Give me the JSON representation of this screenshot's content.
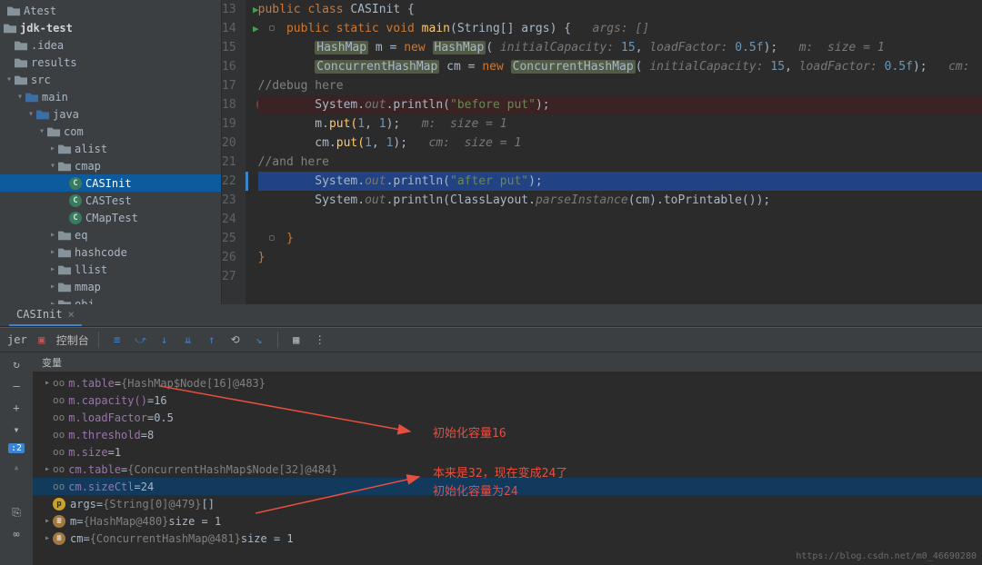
{
  "project": {
    "root_above": "Atest",
    "root": "jdk-test",
    "folders": [
      {
        "label": ".idea",
        "depth": 1,
        "arrow": ""
      },
      {
        "label": "results",
        "depth": 1,
        "arrow": ""
      },
      {
        "label": "src",
        "depth": 1,
        "arrow": "v"
      },
      {
        "label": "main",
        "depth": 2,
        "arrow": "v",
        "blue": true
      },
      {
        "label": "java",
        "depth": 3,
        "arrow": "v",
        "blue": true
      },
      {
        "label": "com",
        "depth": 4,
        "arrow": "v"
      },
      {
        "label": "alist",
        "depth": 5,
        "arrow": ">"
      },
      {
        "label": "cmap",
        "depth": 5,
        "arrow": "v"
      }
    ],
    "classes": [
      {
        "label": "CASInit",
        "sel": true
      },
      {
        "label": "CASTest"
      },
      {
        "label": "CMapTest"
      }
    ],
    "folders2": [
      {
        "label": "eq",
        "depth": 5,
        "arrow": ">"
      },
      {
        "label": "hashcode",
        "depth": 5,
        "arrow": ">"
      },
      {
        "label": "llist",
        "depth": 5,
        "arrow": ">"
      },
      {
        "label": "mmap",
        "depth": 5,
        "arrow": ">"
      },
      {
        "label": "obj",
        "depth": 5,
        "arrow": ">"
      }
    ]
  },
  "editor": {
    "lines": [
      13,
      14,
      15,
      16,
      17,
      18,
      19,
      20,
      21,
      22,
      23,
      24,
      25,
      26,
      27
    ],
    "code": {
      "l13": {
        "kw1": "public class",
        "cls": "CASInit",
        "open": " {"
      },
      "l14": {
        "kw1": "public static void",
        "m": " main",
        "args": "(String[] args) {",
        "hint": "   args: []"
      },
      "l15": {
        "cls1": "HashMap",
        "var": " m = ",
        "kw": "new ",
        "cls2": "HashMap",
        "open": "( ",
        "h1": "initialCapacity:",
        "v1": " 15",
        "c": ", ",
        "h2": "loadFactor:",
        "v2": " 0.5f",
        "close": ");",
        "tail": "   m:  size = 1"
      },
      "l16": {
        "cls1": "ConcurrentHashMap",
        "var": " cm = ",
        "kw": "new ",
        "cls2": "ConcurrentHashMap",
        "open": "( ",
        "h1": "initialCapacity:",
        "v1": " 15",
        "c": ", ",
        "h2": "loadFactor:",
        "v2": " 0.5f",
        "close": ");",
        "tail": "   cm:  size ="
      },
      "l17": {
        "cmt": "//debug here"
      },
      "l18": {
        "obj": "System.",
        "fld": "out",
        "m": ".println(",
        "str": "\"before put\"",
        "close": ");"
      },
      "l19": {
        "obj": "m.",
        "m": "put(",
        "n1": "1",
        "c": ", ",
        "n2": "1",
        "close": ");",
        "tail": "   m:  size = 1"
      },
      "l20": {
        "obj": "cm.",
        "m": "put(",
        "n1": "1",
        "c": ", ",
        "n2": "1",
        "close": ");",
        "tail": "   cm:  size = 1"
      },
      "l21": {
        "cmt": "//and here"
      },
      "l22": {
        "obj": "System.",
        "fld": "out",
        "m": ".println(",
        "str": "\"after put\"",
        "close": ");"
      },
      "l23": {
        "obj": "System.",
        "fld": "out",
        "m": ".println(ClassLayout.",
        "mi": "parseInstance",
        "args": "(cm).toPrintable());"
      },
      "l25": {
        "close": "}"
      },
      "l26": {
        "close": "}"
      }
    }
  },
  "tab": {
    "name": "CASInit",
    "close": "×"
  },
  "toolbar": {
    "jer": "jer",
    "console": "控制台"
  },
  "vars": {
    "header": "变量",
    "rows": [
      {
        "arrow": ">",
        "ico": "f",
        "name": "m.table",
        "eq": " = ",
        "val": "{HashMap$Node[16]@483}"
      },
      {
        "arrow": "",
        "ico": "f",
        "name": "m.capacity()",
        "eq": " = ",
        "sz": "16"
      },
      {
        "arrow": "",
        "ico": "f",
        "name": "m.loadFactor",
        "eq": " = ",
        "sz": "0.5"
      },
      {
        "arrow": "",
        "ico": "f",
        "name": "m.threshold",
        "eq": " = ",
        "sz": "8"
      },
      {
        "arrow": "",
        "ico": "f",
        "name": "m.size",
        "eq": " = ",
        "sz": "1"
      },
      {
        "arrow": ">",
        "ico": "f",
        "name": "cm.table",
        "eq": " = ",
        "val": "{ConcurrentHashMap$Node[32]@484}"
      },
      {
        "arrow": "",
        "ico": "f",
        "name": "cm.sizeCtl",
        "eq": " = ",
        "sz": "24",
        "sel": true
      },
      {
        "arrow": "",
        "ico": "p",
        "name": "args",
        "eq": " = ",
        "val": "{String[0]@479} ",
        "sz": "[]"
      },
      {
        "arrow": ">",
        "ico": "m",
        "name": "m",
        "eq": " = ",
        "val": "{HashMap@480}  ",
        "sz": "size = 1"
      },
      {
        "arrow": ">",
        "ico": "m",
        "name": "cm",
        "eq": " = ",
        "val": "{ConcurrentHashMap@481}  ",
        "sz": "size = 1"
      }
    ]
  },
  "annotations": {
    "a1": "初始化容量16",
    "a2": "本来是32，现在变成24了",
    "a3": "初始化容量为24"
  },
  "watermark": "https://blog.csdn.net/m0_46690280"
}
